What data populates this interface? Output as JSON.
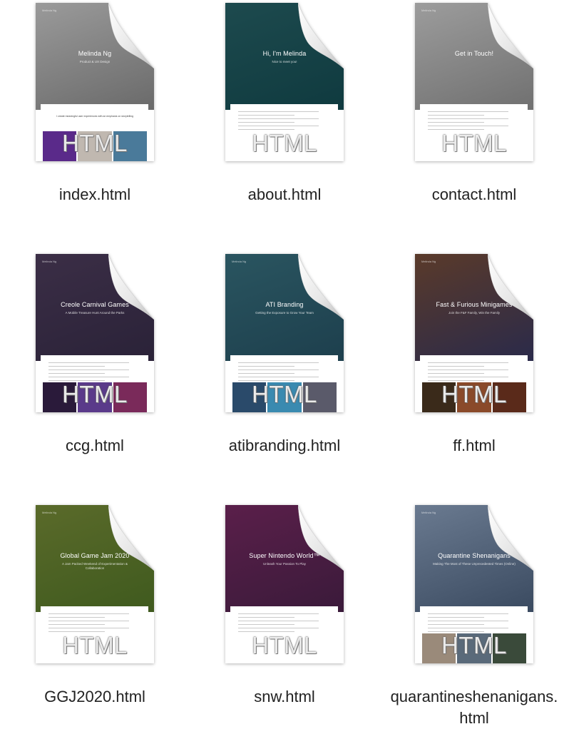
{
  "files": [
    {
      "name": "index.html",
      "brand": "Melinda Ng",
      "title": "Melinda Ng",
      "subtitle": "Product & UX Design",
      "hero": "#6a6a6a",
      "hero2": "#9a9a9a",
      "card_text": "I create meaningful user experiences with an emphasis on storytelling",
      "gallery": [
        "#5a2a8a",
        "#c0b8b0",
        "#4a7a9a"
      ],
      "badge": "HTML"
    },
    {
      "name": "about.html",
      "brand": "",
      "title": "Hi, I'm Melinda",
      "subtitle": "Nice to meet you!",
      "hero": "#0f3a3f",
      "hero2": "#1d4a4e",
      "card_text": "",
      "gallery": [],
      "badge": "HTML"
    },
    {
      "name": "contact.html",
      "brand": "Melinda Ng",
      "title": "Get in Touch!",
      "subtitle": "",
      "hero": "#707070",
      "hero2": "#9c9c9c",
      "card_text": "",
      "gallery": [],
      "badge": "HTML"
    },
    {
      "name": "ccg.html",
      "brand": "Melinda Ng",
      "title": "Creole Carnival Games",
      "subtitle": "A Mobile Treasure Hunt Around the Parks",
      "hero": "#2a2238",
      "hero2": "#3b2e46",
      "card_text": "",
      "gallery": [
        "#2a1a3a",
        "#5a3a8a",
        "#7a2a5a"
      ],
      "badge": "HTML"
    },
    {
      "name": "atibranding.html",
      "brand": "Melinda Ng",
      "title": "ATI Branding",
      "subtitle": "Getting the Exposure to Grow Your Team",
      "hero": "#1d3f4d",
      "hero2": "#2a5560",
      "card_text": "",
      "gallery": [
        "#2a4a6a",
        "#3a8ab0",
        "#5a5a6a"
      ],
      "badge": "HTML"
    },
    {
      "name": "ff.html",
      "brand": "Melinda Ng",
      "title": "Fast & Furious Minigames",
      "subtitle": "Join the F&F Family, Win the Family",
      "hero": "#2a2a4a",
      "hero2": "#5a3a2a",
      "card_text": "",
      "gallery": [
        "#3a2a1a",
        "#8a4a2a",
        "#5a2a1a"
      ],
      "badge": "HTML"
    },
    {
      "name": "GGJ2020.html",
      "brand": "Melinda Ng",
      "title": "Global Game Jam 2020",
      "subtitle": "A Jam Packed Weekend of Experimentation & Collaboration",
      "hero": "#3f5a1e",
      "hero2": "#5a6a2a",
      "card_text": "",
      "gallery": [],
      "badge": "HTML"
    },
    {
      "name": "snw.html",
      "brand": "",
      "title": "Super Nintendo World™",
      "subtitle": "Unleash Your Passion To Play",
      "hero": "#3a1a3a",
      "hero2": "#5a1f4a",
      "card_text": "",
      "gallery": [],
      "badge": "HTML"
    },
    {
      "name": "quarantineshenanigans.\nhtml",
      "brand": "Melinda Ng",
      "title": "Quarantine Shenanigans",
      "subtitle": "Making The Most of These Unprecedented Times (Online)",
      "hero": "#3a4a60",
      "hero2": "#6a7a90",
      "card_text": "",
      "gallery": [
        "#9a8a7a",
        "#5a6a7a",
        "#3a4a3a"
      ],
      "badge": "HTML"
    }
  ]
}
